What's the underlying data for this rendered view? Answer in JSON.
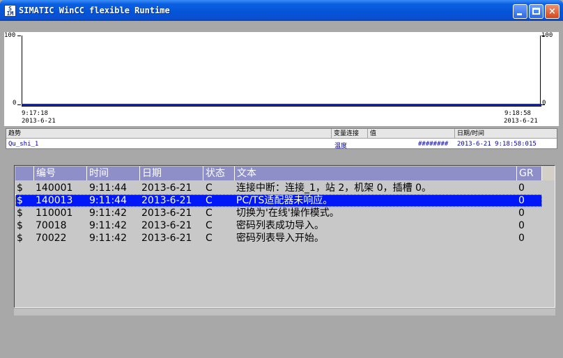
{
  "window": {
    "title": "SIMATIC WinCC flexible Runtime",
    "icon_text": "SIMATIC",
    "buttons": {
      "minimize": "minimize",
      "maximize": "maximize",
      "close": "×"
    }
  },
  "trend": {
    "y_max_left": "100",
    "y_min_left": "0",
    "y_max_right": "100",
    "y_min_right": "0",
    "x_start_time": "9:17:18",
    "x_start_date": "2013-6-21",
    "x_end_time": "9:18:58",
    "x_end_date": "2013-6-21",
    "line_color": "#1424c8",
    "value": 0
  },
  "trend_legend": {
    "headers": {
      "trend": "趋势",
      "variable": "变量连接",
      "value": "值",
      "datetime": "日期/时间"
    },
    "row": {
      "trend": "Qu_shi_1",
      "variable": "温度",
      "value": "########",
      "datetime": "2013-6-21  9:18:58:015"
    }
  },
  "alarms": {
    "headers": {
      "flag": "",
      "number": "编号",
      "time": "时间",
      "date": "日期",
      "status": "状态",
      "text": "文本",
      "group": "GR"
    },
    "rows": [
      {
        "flag": "$",
        "number": "140001",
        "time": "9:11:44",
        "date": "2013-6-21",
        "status": "C",
        "text": "连接中断：连接_1，站 2，机架 0，插槽 0。",
        "group": "0"
      },
      {
        "flag": "$",
        "number": "140013",
        "time": "9:11:44",
        "date": "2013-6-21",
        "status": "C",
        "text": "PC/TS适配器未响应。",
        "group": "0"
      },
      {
        "flag": "$",
        "number": "110001",
        "time": "9:11:42",
        "date": "2013-6-21",
        "status": "C",
        "text": "切换为'在线'操作模式。",
        "group": "0"
      },
      {
        "flag": "$",
        "number": "70018",
        "time": "9:11:42",
        "date": "2013-6-21",
        "status": "C",
        "text": "密码列表成功导入。",
        "group": "0"
      },
      {
        "flag": "$",
        "number": "70022",
        "time": "9:11:42",
        "date": "2013-6-21",
        "status": "C",
        "text": "密码列表导入开始。",
        "group": "0"
      }
    ],
    "selected_index": 1,
    "header_color": "#8e8ec8",
    "selection_color": "#0018f8"
  }
}
